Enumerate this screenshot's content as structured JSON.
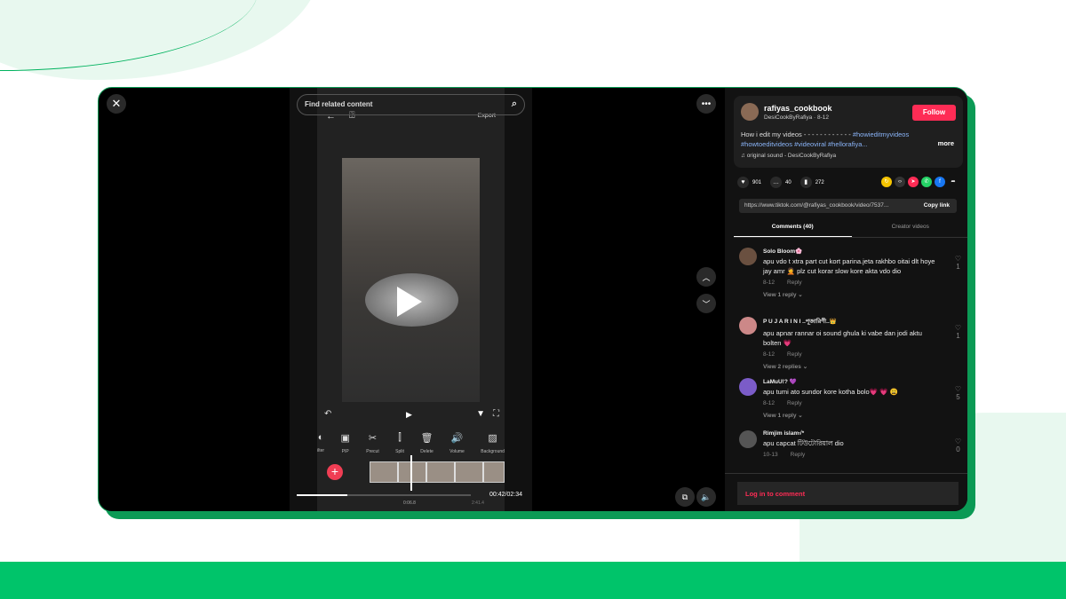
{
  "editor": {
    "search_placeholder": "Find related content",
    "export": "Export",
    "tools": [
      "ilter",
      "PIP",
      "Precut",
      "Split",
      "Delete",
      "Volume",
      "Background"
    ],
    "time": "00:42/02:34",
    "marker": "0:06.8",
    "total": "2:41.4"
  },
  "post": {
    "username": "rafiyas_cookbook",
    "subtitle": "DesiCookByRafiya · 8-12",
    "follow": "Follow",
    "caption": "How i edit my videos - - - - - - - - - - - -",
    "hashtags": [
      "#howieditmyvideos",
      "#howtoeditvideos",
      "#videoviral",
      "#hellorafiya..."
    ],
    "more": "more",
    "sound": "original sound - DesiCookByRafiya",
    "likes": "901",
    "comments": "40",
    "saves": "272",
    "link": "https://www.tiktok.com/@rafiyas_cookbook/video/7537...",
    "copy_link": "Copy link"
  },
  "tabs": {
    "comments": "Comments (40)",
    "creator": "Creator videos"
  },
  "comments": [
    {
      "name": "Solo Bloom🌸",
      "text": "apu vdo t xtra part cut kort parina.jeta rakhbo oitai dlt hoye jay amr 🤦 plz cut korar slow kore akta vdo dio",
      "date": "8-12",
      "reply": "Reply",
      "replies": "View 1 reply",
      "likes": "1"
    },
    {
      "name": "P U J A R I N I ..পূজারিণী..👑",
      "text": "apu apnar rannar oi sound ghula ki vabe dan jodi aktu bolten 💗",
      "date": "8-12",
      "reply": "Reply",
      "replies": "View 2 replies",
      "likes": "1"
    },
    {
      "name": "LaMuU!? 💜",
      "text": "apu tumi ato sundor kore kotha bolo💗 💗 😩",
      "date": "8-12",
      "reply": "Reply",
      "replies": "View 1 reply",
      "likes": "5"
    },
    {
      "name": "Rimjim islam√*",
      "text": "apu capcat টিউটোরিয়াল dio",
      "date": "10-13",
      "reply": "Reply",
      "likes": "0"
    }
  ],
  "login": "Log in to comment"
}
